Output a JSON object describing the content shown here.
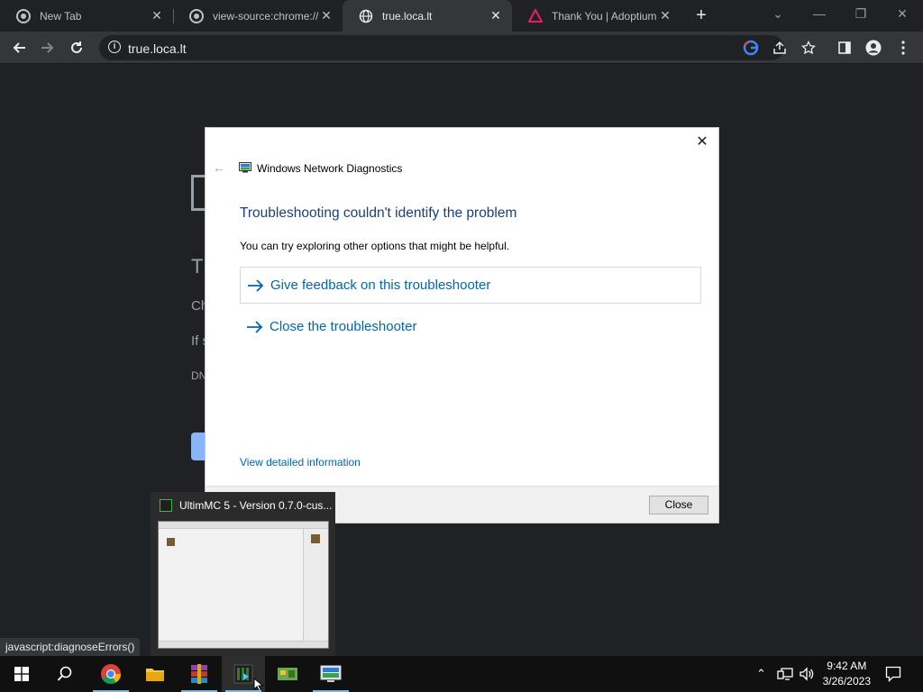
{
  "browser": {
    "tabs": [
      {
        "title": "New Tab",
        "icon": "chrome-icon",
        "active": false
      },
      {
        "title": "view-source:chrome://n",
        "icon": "chrome-icon",
        "active": false
      },
      {
        "title": "true.loca.lt",
        "icon": "globe-icon",
        "active": true
      },
      {
        "title": "Thank You | Adoptium",
        "icon": "adoptium-icon",
        "active": false
      }
    ],
    "url": "true.loca.lt",
    "status_text": "javascript:diagnoseErrors()"
  },
  "background_page": {
    "frag_title": "T",
    "frag_line1": "Ch",
    "frag_line2": "If s",
    "frag_line3": "DN"
  },
  "dialog": {
    "window_title": "Windows Network Diagnostics",
    "heading": "Troubleshooting couldn't identify the problem",
    "subtext": "You can try exploring other options that might be helpful.",
    "options": [
      {
        "label": "Give feedback on this troubleshooter"
      },
      {
        "label": "Close the troubleshooter"
      }
    ],
    "detail_link": "View detailed information",
    "close_button": "Close"
  },
  "thumbnail": {
    "title": "UltimMC 5 - Version 0.7.0-cus..."
  },
  "taskbar": {
    "apps": [
      "start-icon",
      "search-icon",
      "chrome-icon",
      "file-explorer-icon",
      "winrar-icon",
      "ultimmc-icon",
      "network-icon",
      "diagnostics-icon"
    ],
    "time": "9:42 AM",
    "date": "3/26/2023"
  },
  "colors": {
    "accent_link": "#0066b4",
    "heading_blue": "#1b3e80",
    "taskbar_indicator": "#76b9ed"
  }
}
